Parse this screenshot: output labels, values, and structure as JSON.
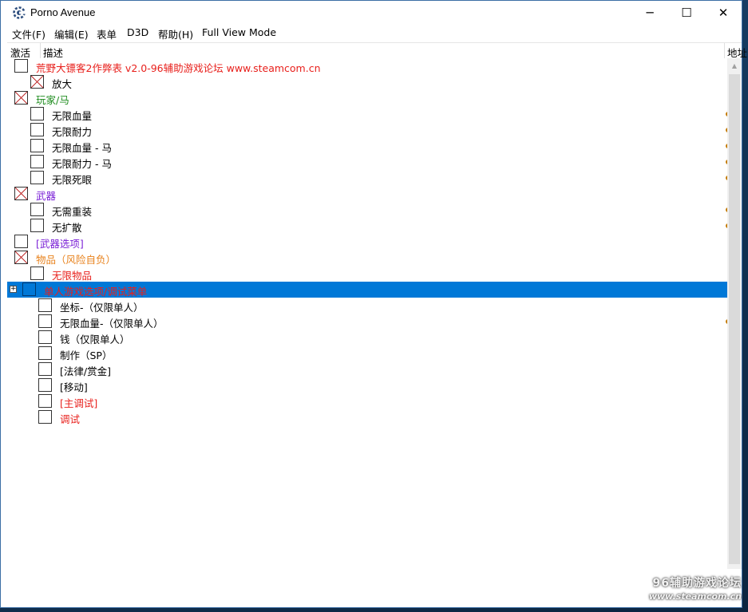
{
  "window": {
    "title": "Porno Avenue",
    "app_icon": "cheat-engine-gear-icon",
    "controls": {
      "minimize": "─",
      "maximize": "☐",
      "close": "✕"
    }
  },
  "menubar": {
    "items": [
      "文件(F)",
      "编辑(E)",
      "表单",
      "D3D",
      "帮助(H)",
      "Full View Mode"
    ]
  },
  "table": {
    "columns": {
      "active": "激活",
      "description": "描述",
      "address": "地址"
    },
    "rows": [
      {
        "label": "荒野大镖客2作弊表 v2.0-96辅助游戏论坛 www.steamcom.cn",
        "checked": false,
        "color": "#e8201c"
      },
      {
        "label": "放大",
        "checked": true,
        "color": "#000000"
      },
      {
        "label": "玩家/马",
        "checked": true,
        "color": "#1e8c1e"
      },
      {
        "label": "无限血量",
        "checked": false,
        "color": "#000000"
      },
      {
        "label": "无限耐力",
        "checked": false,
        "color": "#000000"
      },
      {
        "label": "无限血量 - 马",
        "checked": false,
        "color": "#000000"
      },
      {
        "label": "无限耐力 - 马",
        "checked": false,
        "color": "#000000"
      },
      {
        "label": "无限死眼",
        "checked": false,
        "color": "#000000"
      },
      {
        "label": "武器",
        "checked": true,
        "color": "#7a1fd6"
      },
      {
        "label": "无需重装",
        "checked": false,
        "color": "#000000"
      },
      {
        "label": "无扩散",
        "checked": false,
        "color": "#000000"
      },
      {
        "label": "[武器选项]",
        "checked": false,
        "color": "#7a1fd6"
      },
      {
        "label": "物品（风险自负）",
        "checked": true,
        "color": "#e8821c"
      },
      {
        "label": "无限物品",
        "checked": false,
        "color": "#e8201c"
      },
      {
        "label": "单人游戏选项/调试菜单",
        "checked": false,
        "color": "#e8201c",
        "selected": true
      },
      {
        "label": "坐标-（仅限单人）",
        "checked": false,
        "color": "#000000"
      },
      {
        "label": "无限血量-（仅限单人）",
        "checked": false,
        "color": "#000000"
      },
      {
        "label": "钱（仅限单人）",
        "checked": false,
        "color": "#000000"
      },
      {
        "label": "制作（SP）",
        "checked": false,
        "color": "#000000"
      },
      {
        "label": "[法律/赏金]",
        "checked": false,
        "color": "#000000"
      },
      {
        "label": "[移动]",
        "checked": false,
        "color": "#000000"
      },
      {
        "label": "[主调试]",
        "checked": false,
        "color": "#e8201c"
      },
      {
        "label": "调试",
        "checked": false,
        "color": "#e8201c"
      }
    ]
  },
  "watermark": {
    "line1": "96辅助游戏论坛",
    "line2": "www.steamcom.cn"
  },
  "colors": {
    "selection": "#0078d7",
    "checked_cross": "#c03030",
    "address_marker": "#c47a00"
  }
}
